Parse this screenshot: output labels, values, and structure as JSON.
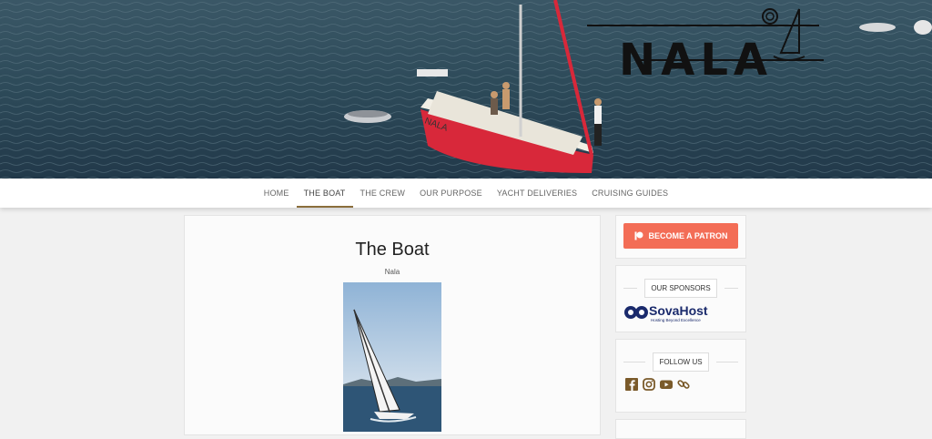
{
  "header": {
    "logo_text": "NALA",
    "boat_name": "NALA"
  },
  "nav": {
    "items": [
      {
        "label": "HOME"
      },
      {
        "label": "THE BOAT",
        "active": true
      },
      {
        "label": "THE CREW"
      },
      {
        "label": "OUR PURPOSE"
      },
      {
        "label": "YACHT DELIVERIES"
      },
      {
        "label": "CRUISING GUIDES"
      }
    ]
  },
  "main": {
    "title": "The Boat",
    "subtitle": "Nala"
  },
  "sidebar": {
    "patron_label": "BECOME A PATRON",
    "sponsors_title": "OUR SPONSORS",
    "sponsor_name": "SovaHost",
    "sponsor_tagline": "Hosting Beyond Excellence",
    "follow_title": "FOLLOW US",
    "social_icons": [
      "facebook-icon",
      "instagram-icon",
      "youtube-icon",
      "link-icon"
    ]
  },
  "colors": {
    "accent": "#8a6d3b",
    "patron": "#f36d56",
    "sea": "#2f4d5c",
    "hull": "#d8283a",
    "sponsor_blue": "#1a2a6c"
  }
}
